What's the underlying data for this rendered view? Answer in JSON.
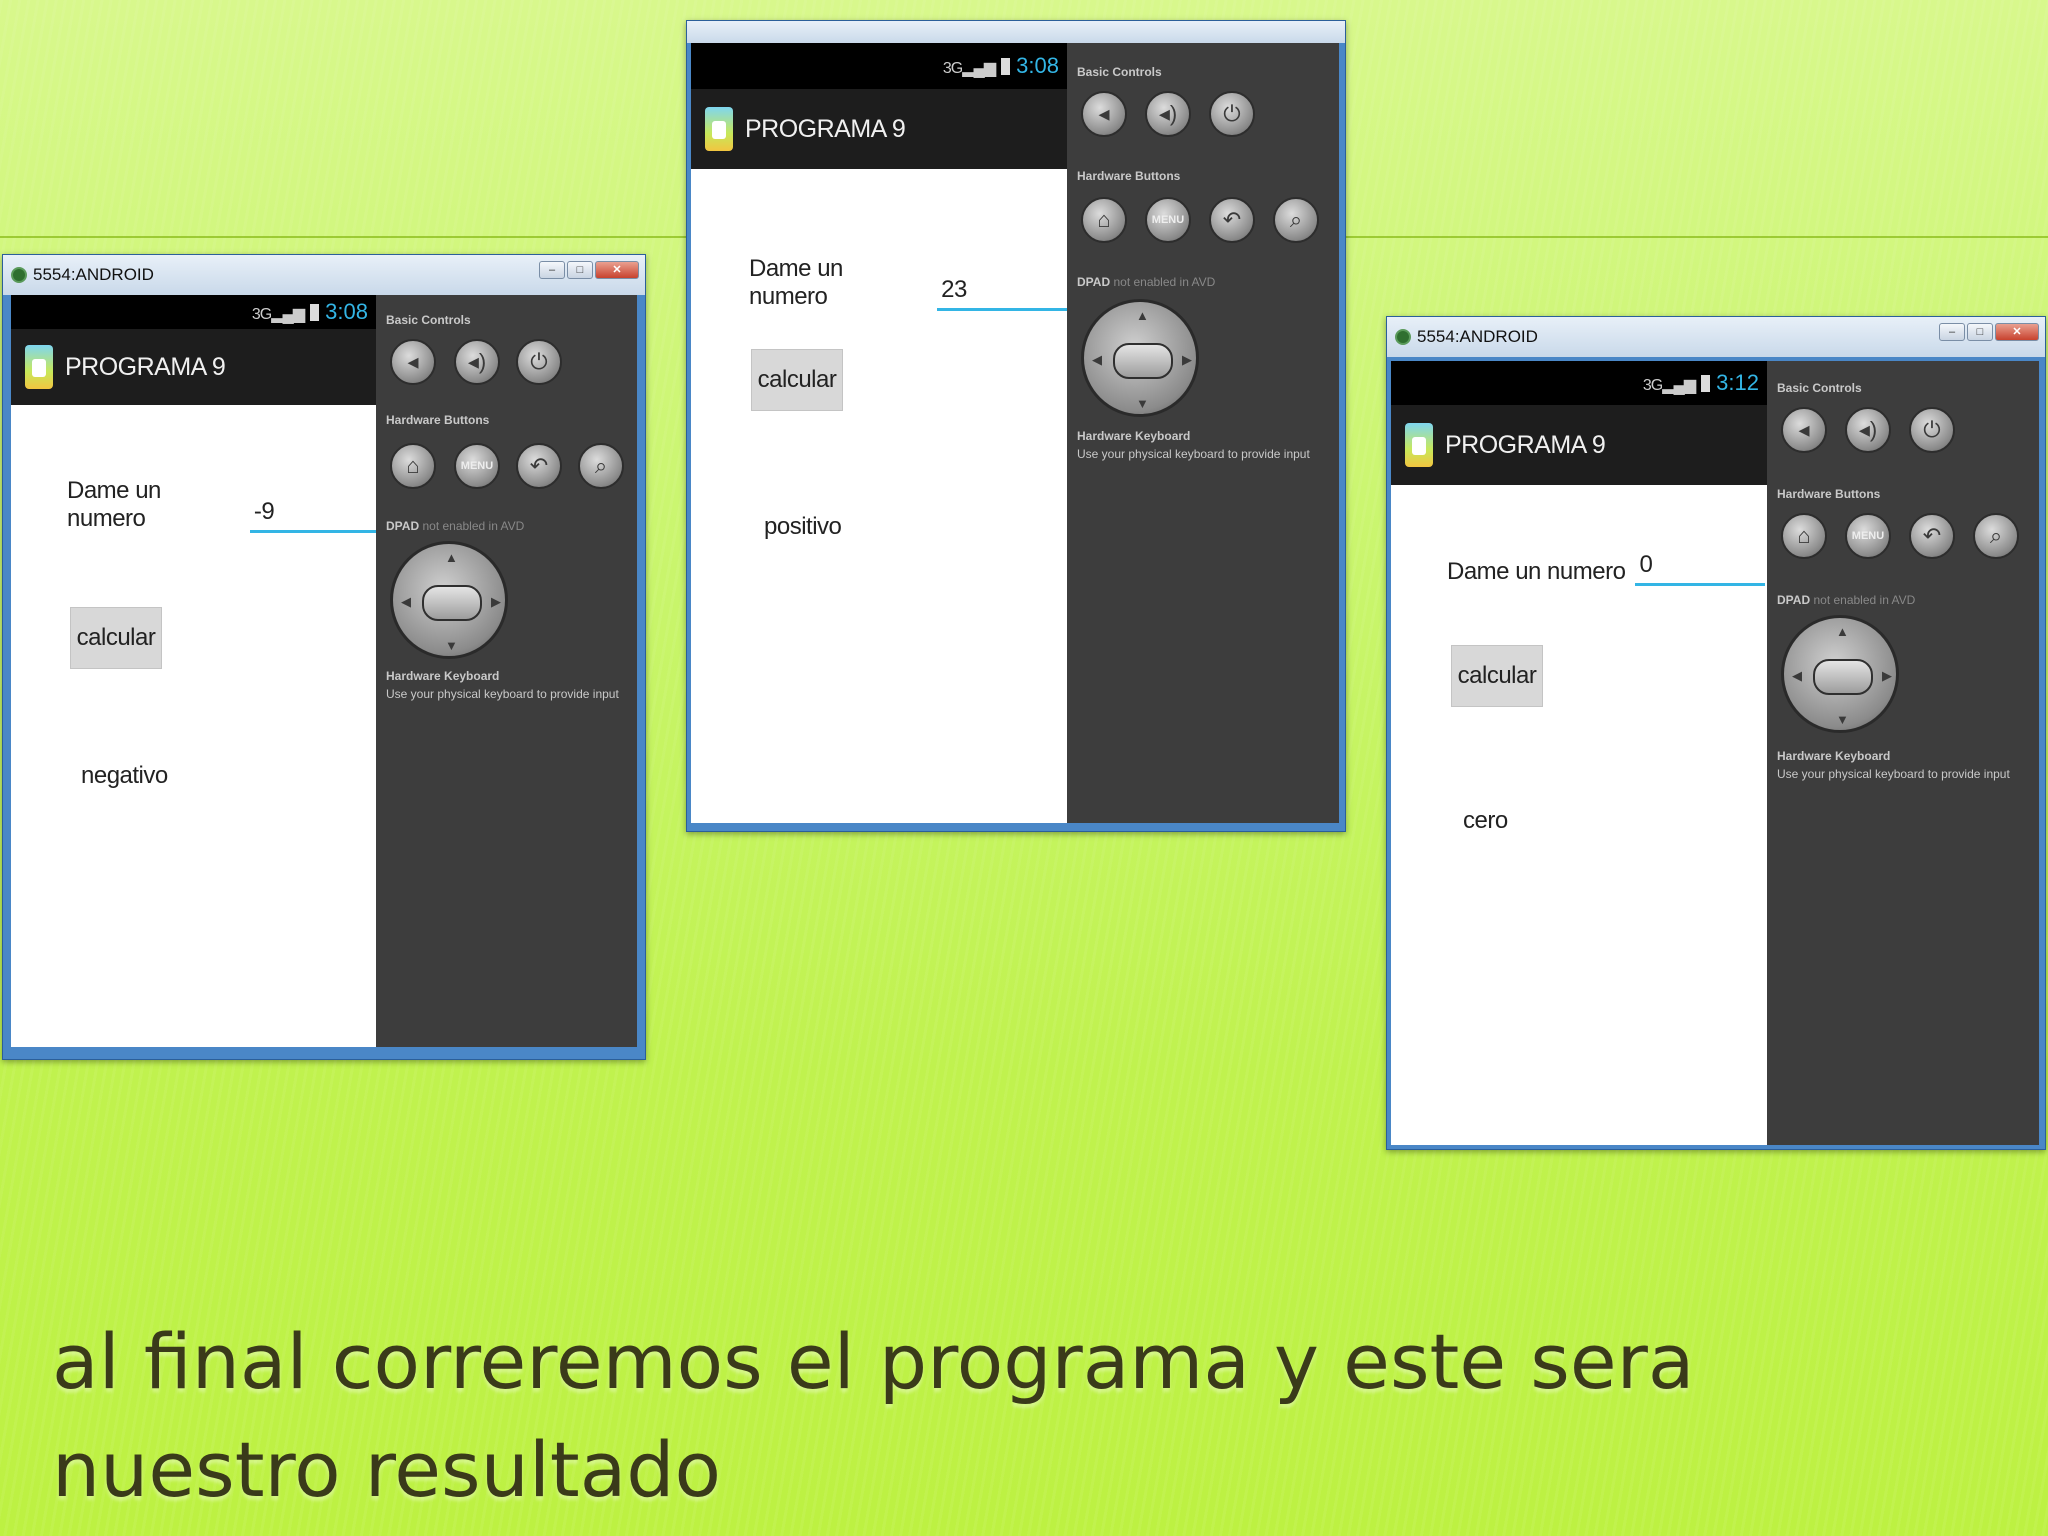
{
  "windows": [
    {
      "id": "left",
      "title": "5554:ANDROID",
      "time": "3:08",
      "app_title": "PROGRAMA 9",
      "prompt_label": "Dame un numero",
      "input_value": "-9",
      "button_label": "calcular",
      "result": "negativo"
    },
    {
      "id": "middle",
      "title": "",
      "time": "3:08",
      "app_title": "PROGRAMA 9",
      "prompt_label": "Dame un numero",
      "input_value": "23",
      "button_label": "calcular",
      "result": "positivo"
    },
    {
      "id": "right",
      "title": "5554:ANDROID",
      "time": "3:12",
      "app_title": "PROGRAMA 9",
      "prompt_label": "Dame un numero",
      "input_value": "0",
      "button_label": "calcular",
      "result": "cero"
    }
  ],
  "panel": {
    "basic_controls": "Basic Controls",
    "hardware_buttons": "Hardware Buttons",
    "dpad_label": "DPAD",
    "dpad_note": "not enabled in AVD",
    "keyboard_title": "Hardware Keyboard",
    "keyboard_note": "Use your physical keyboard to provide input",
    "menu_label": "MENU"
  },
  "icons": [
    "volume-down-icon",
    "volume-up-icon",
    "power-icon",
    "home-icon",
    "menu-icon",
    "back-icon",
    "search-icon"
  ],
  "caption": "al final correremos el programa y este sera nuestro resultado"
}
